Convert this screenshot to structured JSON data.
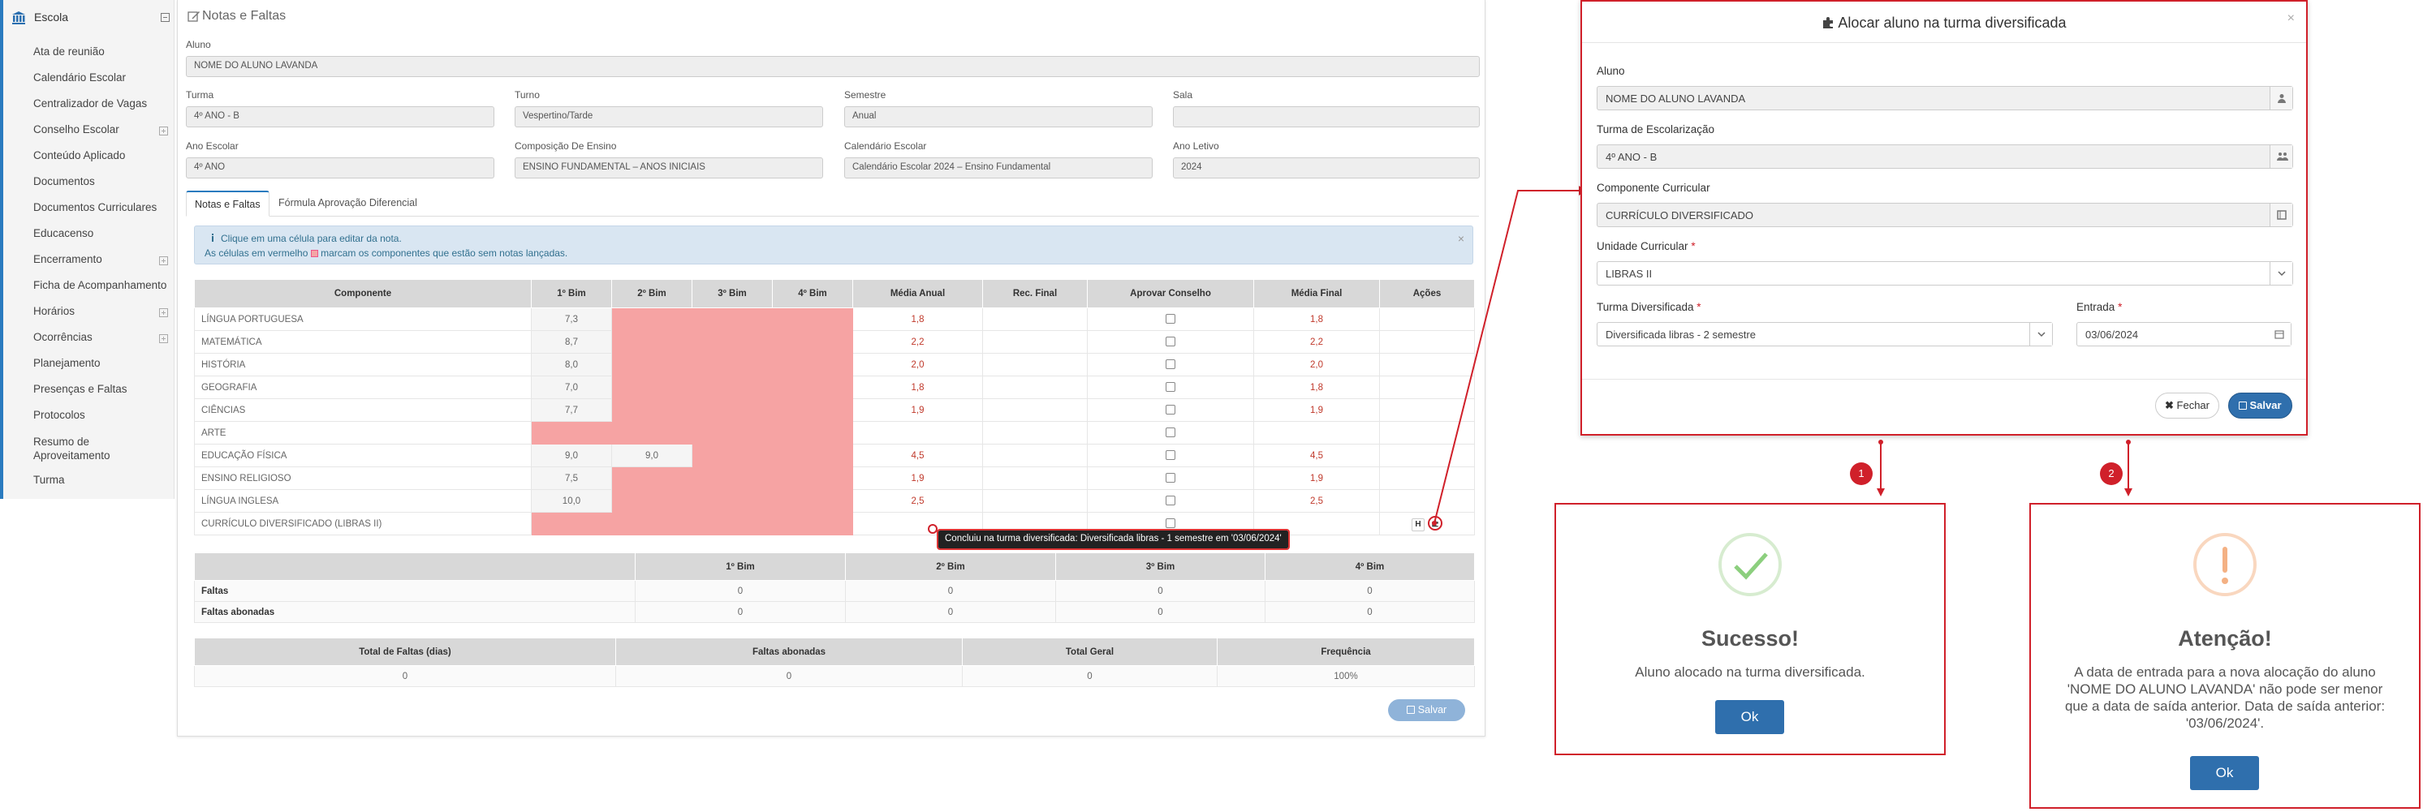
{
  "sidebar": {
    "title": "Escola",
    "items": [
      {
        "label": "Ata de reunião",
        "expandable": false
      },
      {
        "label": "Calendário Escolar",
        "expandable": false
      },
      {
        "label": "Centralizador de Vagas",
        "expandable": false
      },
      {
        "label": "Conselho Escolar",
        "expandable": true
      },
      {
        "label": "Conteúdo Aplicado",
        "expandable": false
      },
      {
        "label": "Documentos",
        "expandable": false
      },
      {
        "label": "Documentos Curriculares",
        "expandable": false
      },
      {
        "label": "Educacenso",
        "expandable": false
      },
      {
        "label": "Encerramento",
        "expandable": true
      },
      {
        "label": "Ficha de Acompanhamento",
        "expandable": false
      },
      {
        "label": "Horários",
        "expandable": true
      },
      {
        "label": "Ocorrências",
        "expandable": true
      },
      {
        "label": "Planejamento",
        "expandable": false
      },
      {
        "label": "Presenças e Faltas",
        "expandable": false
      },
      {
        "label": "Protocolos",
        "expandable": false
      },
      {
        "label": "Resumo de Aproveitamento",
        "expandable": false
      },
      {
        "label": "Turma",
        "expandable": false
      }
    ]
  },
  "main": {
    "title": "Notas e Faltas",
    "fields": {
      "aluno_label": "Aluno",
      "aluno_value": "NOME DO ALUNO LAVANDA",
      "turma_label": "Turma",
      "turma_value": "4º ANO - B",
      "turno_label": "Turno",
      "turno_value": "Vespertino/Tarde",
      "semestre_label": "Semestre",
      "semestre_value": "Anual",
      "sala_label": "Sala",
      "sala_value": "",
      "ano_escolar_label": "Ano Escolar",
      "ano_escolar_value": "4º ANO",
      "composicao_label": "Composição De Ensino",
      "composicao_value": "ENSINO FUNDAMENTAL – ANOS INICIAIS",
      "calendario_label": "Calendário Escolar",
      "calendario_value": "Calendário Escolar 2024 – Ensino Fundamental",
      "ano_letivo_label": "Ano Letivo",
      "ano_letivo_value": "2024"
    },
    "tabs": [
      {
        "label": "Notas e Faltas",
        "active": true
      },
      {
        "label": "Fórmula Aprovação Diferencial",
        "active": false
      }
    ],
    "info": {
      "line1": "Clique em uma célula para editar da nota.",
      "line2_pre": "As células em vermelho",
      "line2_post": "marcam os componentes que estão sem notas lançadas."
    },
    "grades_headers": [
      "Componente",
      "1º Bim",
      "2º Bim",
      "3º Bim",
      "4º Bim",
      "Média Anual",
      "Rec. Final",
      "Aprovar Conselho",
      "Média Final",
      "Ações"
    ],
    "grades": [
      {
        "comp": "LÍNGUA PORTUGUESA",
        "b1": "7,3",
        "b2": "",
        "b3": "",
        "b4": "",
        "media": "1,8",
        "rec": "",
        "final": "1,8",
        "pink": [
          false,
          true,
          true,
          true
        ]
      },
      {
        "comp": "MATEMÁTICA",
        "b1": "8,7",
        "b2": "",
        "b3": "",
        "b4": "",
        "media": "2,2",
        "rec": "",
        "final": "2,2",
        "pink": [
          false,
          true,
          true,
          true
        ]
      },
      {
        "comp": "HISTÓRIA",
        "b1": "8,0",
        "b2": "",
        "b3": "",
        "b4": "",
        "media": "2,0",
        "rec": "",
        "final": "2,0",
        "pink": [
          false,
          true,
          true,
          true
        ]
      },
      {
        "comp": "GEOGRAFIA",
        "b1": "7,0",
        "b2": "",
        "b3": "",
        "b4": "",
        "media": "1,8",
        "rec": "",
        "final": "1,8",
        "pink": [
          false,
          true,
          true,
          true
        ]
      },
      {
        "comp": "CIÊNCIAS",
        "b1": "7,7",
        "b2": "",
        "b3": "",
        "b4": "",
        "media": "1,9",
        "rec": "",
        "final": "1,9",
        "pink": [
          false,
          true,
          true,
          true
        ]
      },
      {
        "comp": "ARTE",
        "b1": "",
        "b2": "",
        "b3": "",
        "b4": "",
        "media": "",
        "rec": "",
        "final": "",
        "pink": [
          true,
          true,
          true,
          true
        ]
      },
      {
        "comp": "EDUCAÇÃO FÍSICA",
        "b1": "9,0",
        "b2": "9,0",
        "b3": "",
        "b4": "",
        "media": "4,5",
        "rec": "",
        "final": "4,5",
        "pink": [
          false,
          false,
          true,
          true
        ]
      },
      {
        "comp": "ENSINO RELIGIOSO",
        "b1": "7,5",
        "b2": "",
        "b3": "",
        "b4": "",
        "media": "1,9",
        "rec": "",
        "final": "1,9",
        "pink": [
          false,
          true,
          true,
          true
        ]
      },
      {
        "comp": "LÍNGUA INGLESA",
        "b1": "10,0",
        "b2": "",
        "b3": "",
        "b4": "",
        "media": "2,5",
        "rec": "",
        "final": "2,5",
        "pink": [
          false,
          true,
          true,
          true
        ]
      },
      {
        "comp": "CURRÍCULO DIVERSIFICADO (LIBRAS II)",
        "b1": "",
        "b2": "",
        "b3": "",
        "b4": "",
        "media": "",
        "rec": "",
        "final": "",
        "pink": [
          true,
          true,
          true,
          true
        ],
        "actions": true
      }
    ],
    "h_button": "H",
    "tooltip": "Concluiu na turma diversificada: Diversificada libras - 1 semestre em '03/06/2024'",
    "absences_headers": [
      "",
      "1º Bim",
      "2º Bim",
      "3º Bim",
      "4º Bim"
    ],
    "absences": [
      {
        "label": "Faltas",
        "values": [
          "0",
          "0",
          "0",
          "0"
        ]
      },
      {
        "label": "Faltas abonadas",
        "values": [
          "0",
          "0",
          "0",
          "0"
        ]
      }
    ],
    "totals_headers": [
      "Total de Faltas (dias)",
      "Faltas abonadas",
      "Total Geral",
      "Frequência"
    ],
    "totals_values": [
      "0",
      "0",
      "0",
      "100%"
    ],
    "save_label": "Salvar"
  },
  "modal": {
    "title": "Alocar aluno na turma diversificada",
    "aluno_label": "Aluno",
    "aluno_value": "NOME DO ALUNO LAVANDA",
    "turma_label": "Turma de Escolarização",
    "turma_value": "4º ANO - B",
    "componente_label": "Componente Curricular",
    "componente_value": "CURRÍCULO DIVERSIFICADO",
    "unidade_label": "Unidade Curricular",
    "unidade_value": "LIBRAS II",
    "turma_div_label": "Turma Diversificada",
    "turma_div_value": "Diversificada libras - 2 semestre",
    "entrada_label": "Entrada",
    "entrada_value": "03/06/2024",
    "close_label": "Fechar",
    "save_label": "Salvar"
  },
  "success": {
    "badge": "1",
    "title": "Sucesso!",
    "text": "Aluno alocado na turma diversificada.",
    "ok": "Ok"
  },
  "warning": {
    "badge": "2",
    "title": "Atenção!",
    "text": "A data de entrada para a nova alocação do aluno 'NOME DO ALUNO LAVANDA' não pode ser menor que a data de saída anterior. Data de saída anterior: '03/06/2024'.",
    "ok": "Ok"
  },
  "colors": {
    "accent": "#2f6fad",
    "annotation": "#d0202a",
    "missing_grade": "#f6a3a3",
    "success": "#7fc27f",
    "warning": "#f0ad7e"
  }
}
